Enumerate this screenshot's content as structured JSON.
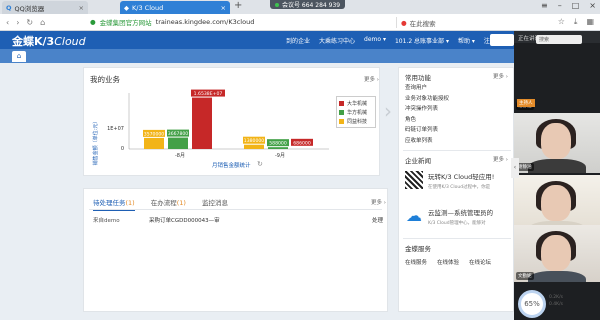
{
  "browser": {
    "tabs": [
      {
        "title": "QQ浏览器",
        "active": false
      },
      {
        "title": "K/3 Cloud",
        "active": true
      }
    ],
    "meeting_badge": "会议号 664 284 939",
    "site_name": "金蝶集团官方网站",
    "url": "traineas.kingdee.com/K3cloud",
    "search_placeholder": "在此搜索"
  },
  "app": {
    "logo_main": "金蝶K/3",
    "logo_sub": "Cloud",
    "menu": [
      "到的企业",
      "大乘练习中心",
      "demo ▾",
      "101.2 总账事业部 ▾",
      "帮助 ▾",
      "注销"
    ]
  },
  "business": {
    "title": "我的业务",
    "more": "更多",
    "chart_caption": "月销售金额统计"
  },
  "chart_data": {
    "type": "bar",
    "categories": [
      "-8月",
      "-9月"
    ],
    "series": [
      {
        "name": "大华机械",
        "color": "#c62828",
        "values": [
          16530000,
          0
        ]
      },
      {
        "name": "华方机械",
        "color": "#43a047",
        "values": [
          3667800,
          588000
        ]
      },
      {
        "name": "同益科技",
        "color": "#f2b418",
        "values": [
          3570000,
          1380000
        ]
      }
    ],
    "labels": [
      [
        "3570000",
        "3667800",
        "1.6538E+07"
      ],
      [
        "1380000",
        "588000",
        "686000"
      ]
    ],
    "ylabel": "销售金额（单位:元）",
    "ytick": "1E+07",
    "ylim": [
      0,
      18000000
    ]
  },
  "tasks": {
    "tabs": [
      {
        "label": "待处理任务",
        "count": "(1)",
        "active": true
      },
      {
        "label": "在办流程",
        "count": "(1)",
        "active": false
      },
      {
        "label": "监控消息",
        "count": "",
        "active": false
      }
    ],
    "more": "更多",
    "rows": [
      {
        "from": "来自demo",
        "subject": "采购订单CGDD000043—审",
        "action": "处理"
      }
    ]
  },
  "sidebar": {
    "functions_title": "常用功能",
    "functions_more": "更多",
    "functions": [
      "查询用户",
      "业务对象功能授权",
      "冲突操作列表",
      "角色",
      "码链订单列表",
      "应收单列表"
    ],
    "news_title": "企业新闻",
    "news_more": "更多",
    "news": [
      {
        "title": "玩转K/3 Cloud轻应用!",
        "sub": "在使用K/3 Cloud过程中，你是"
      },
      {
        "title": "云监测—系统管理员的",
        "sub": "K/3 Cloud管理中心，能够对"
      }
    ],
    "service_title": "金蝶服务",
    "services": [
      "在线服务",
      "在线体验",
      "在线论坛"
    ]
  },
  "call": {
    "label": "正在讲话:",
    "search": "搜索",
    "host_tag": "主持人",
    "participants": [
      "谢静涵",
      "谢静涵",
      "刘婷婷",
      "文勤妮"
    ]
  },
  "gauge": {
    "value": "65%",
    "line1": "0.2K/s",
    "line2": "0.4K/s"
  }
}
